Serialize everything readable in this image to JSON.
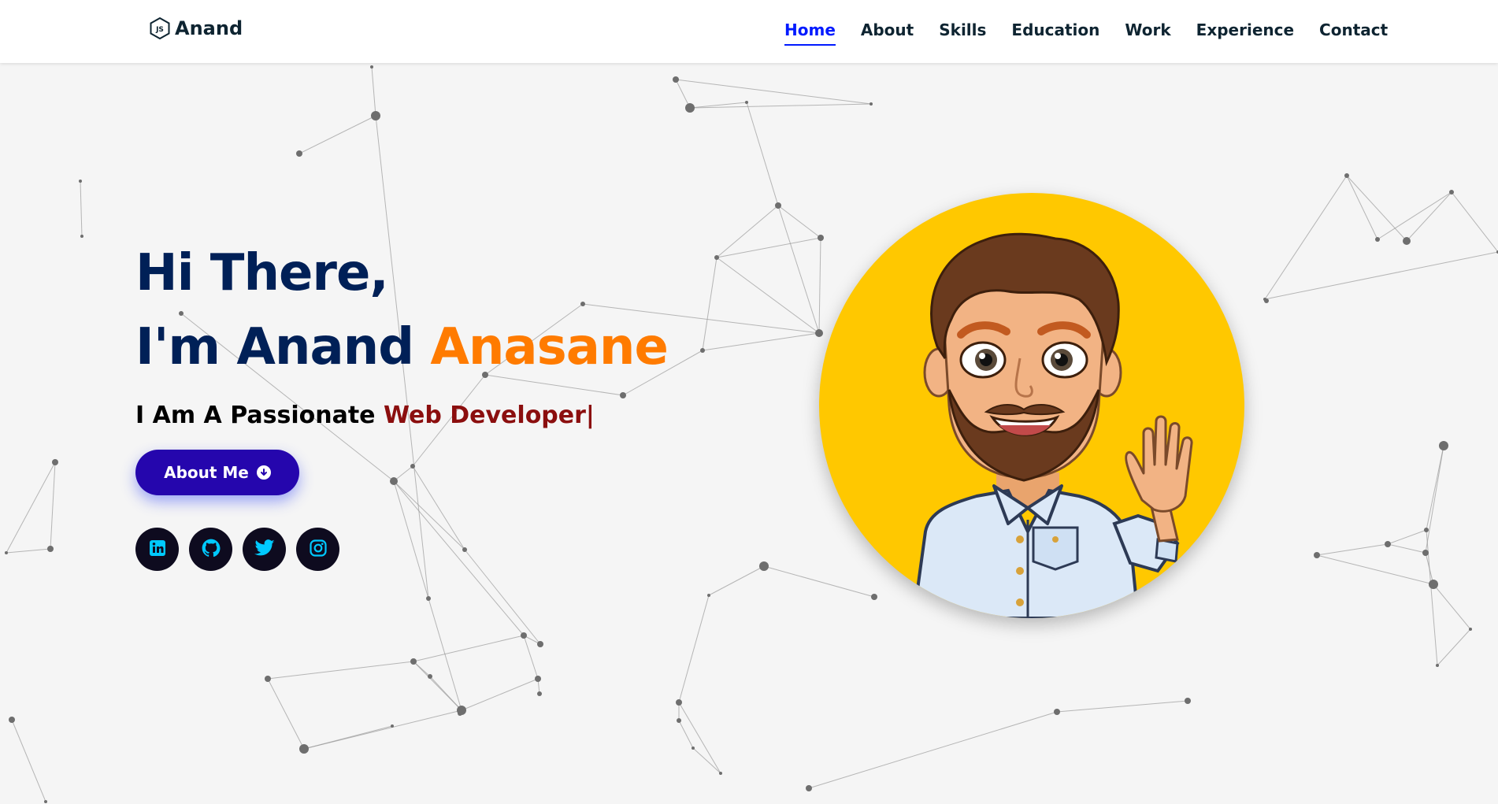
{
  "brand": {
    "name": "Anand",
    "icon": "nodejs-logo-icon"
  },
  "nav": {
    "items": [
      {
        "label": "Home",
        "active": true
      },
      {
        "label": "About",
        "active": false
      },
      {
        "label": "Skills",
        "active": false
      },
      {
        "label": "Education",
        "active": false
      },
      {
        "label": "Work",
        "active": false
      },
      {
        "label": "Experience",
        "active": false
      },
      {
        "label": "Contact",
        "active": false
      }
    ]
  },
  "hero": {
    "greeting": "Hi There,",
    "intro_prefix": "I'm Anand ",
    "intro_accent": "Anasane",
    "tagline_prefix": "I Am A Passionate ",
    "tagline_typed": "Web Developer|",
    "button_label": "About Me",
    "button_icon": "arrow-circle-down-icon"
  },
  "socials": [
    {
      "name": "linkedin",
      "icon": "linkedin-icon"
    },
    {
      "name": "github",
      "icon": "github-icon"
    },
    {
      "name": "twitter",
      "icon": "twitter-icon"
    },
    {
      "name": "instagram",
      "icon": "instagram-icon"
    }
  ],
  "colors": {
    "nav_active": "#011aff",
    "heading": "#002057",
    "accent": "#ff7b00",
    "typed": "#8b0e0e",
    "button": "#2506ad",
    "social_bg": "#0e0b1f",
    "social_icon": "#00c9ff",
    "avatar_bg": "#ffc800"
  }
}
